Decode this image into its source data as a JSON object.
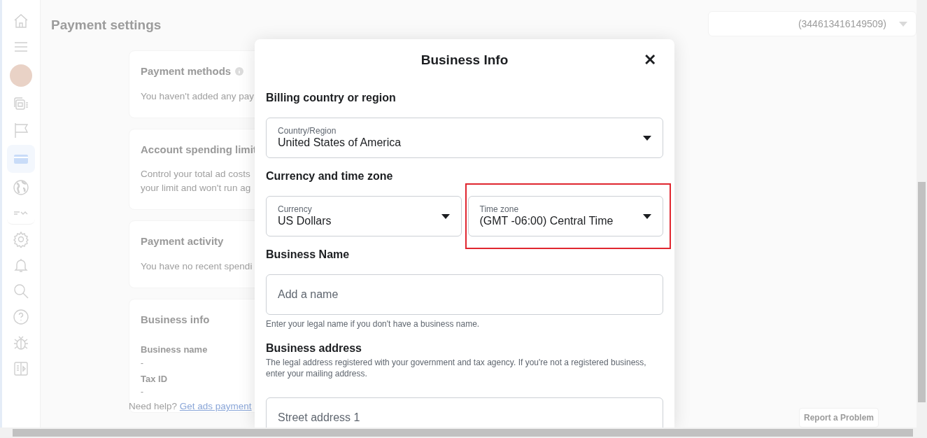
{
  "sidebar": {
    "items": [
      {
        "kind": "home",
        "selected": false
      },
      {
        "kind": "menu",
        "selected": false
      },
      {
        "kind": "avatar",
        "selected": false
      },
      {
        "kind": "pages",
        "selected": false
      },
      {
        "kind": "flag",
        "selected": false
      },
      {
        "kind": "card",
        "selected": true
      },
      {
        "kind": "globe",
        "selected": false
      },
      {
        "kind": "tools",
        "selected": false
      },
      {
        "kind": "gear",
        "selected": false
      },
      {
        "kind": "bell",
        "selected": false
      },
      {
        "kind": "search",
        "selected": false
      },
      {
        "kind": "help",
        "selected": false
      },
      {
        "kind": "bug",
        "selected": false
      },
      {
        "kind": "panel",
        "selected": false
      }
    ]
  },
  "page": {
    "title": "Payment settings",
    "account_selector": {
      "value": "(344613416149509)"
    },
    "cards": [
      {
        "title": "Payment methods",
        "info": true,
        "lines": [
          "You haven't added any pay"
        ]
      },
      {
        "title": "Account spending limit",
        "lines": [
          "Control your total ad costs",
          "your limit and won't run ag"
        ]
      },
      {
        "title": "Payment activity",
        "lines": [
          "You have no recent spendi"
        ]
      },
      {
        "title": "Business info",
        "fields": [
          {
            "label": "Business name",
            "value": "-"
          },
          {
            "label": "Tax ID",
            "value": "-"
          }
        ]
      }
    ],
    "help": {
      "text": "Need help?",
      "link": "Get ads payment"
    },
    "report_button": "Report a Problem"
  },
  "modal": {
    "title": "Business Info",
    "close": "✕",
    "sections": [
      {
        "heading": "Billing country or region",
        "selects": [
          {
            "label": "Country/Region",
            "value": "United States of America"
          }
        ]
      },
      {
        "heading": "Currency and time zone",
        "selects": [
          {
            "label": "Currency",
            "value": "US Dollars"
          },
          {
            "label": "Time zone",
            "value": "(GMT -06:00) Central Time",
            "highlighted": true
          }
        ]
      },
      {
        "heading": "Business Name",
        "input": {
          "placeholder": "Add a name"
        },
        "help": "Enter your legal name if you don't have a business name."
      },
      {
        "heading": "Business address",
        "description": "The legal address registered with your government and tax agency. If you're not a registered business, enter your mailing address.",
        "input": {
          "placeholder": "Street address 1"
        }
      }
    ]
  }
}
